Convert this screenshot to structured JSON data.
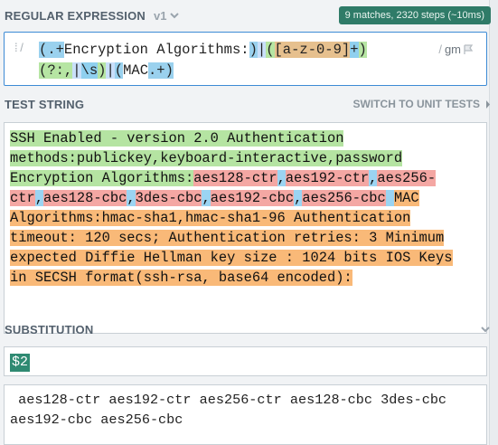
{
  "regex_section": {
    "title": "REGULAR EXPRESSION",
    "flavor": "v1",
    "match_info": "9 matches, 2320 steps (~10ms)",
    "delimiter_open": "/",
    "delimiter_close": "/",
    "flags": "gm",
    "line1": {
      "p_open1": "(",
      "p_dotplus1": ".+",
      "p_literal": "Encryption Algorithms:",
      "p_close1": ")",
      "p_alt1": "|",
      "p_open2": "(",
      "p_class": "[a-z-0-9]",
      "p_plus2": "+",
      "p_close2": ")"
    },
    "line2": {
      "p_open3": "(",
      "p_nc": "?:",
      "p_comma": ",",
      "p_alt2": "|",
      "p_ws": "\\s",
      "p_close3": ")",
      "p_alt3": "|",
      "p_open4": "(",
      "p_mac": "MAC",
      "p_dotplus2": ".+",
      "p_close4": ")"
    }
  },
  "test_section": {
    "title": "TEST STRING",
    "switch_label": "SWITCH TO UNIT TESTS",
    "line1": "SSH Enabled - version 2.0 Authentication",
    "line2": "methods:publickey,keyboard-interactive,password",
    "line3_a": "Encryption Algorithms:",
    "line3_b": "aes128-ctr",
    "line3_c": ",",
    "line3_d": "aes192-ctr",
    "line3_e": ",",
    "line3_f": "aes256-",
    "line4_a": "ctr",
    "line4_b": ",",
    "line4_c": "aes128-cbc",
    "line4_d": ",",
    "line4_e": "3des-cbc",
    "line4_f": ",",
    "line4_g": "aes192-cbc",
    "line4_h": ",",
    "line4_i": "aes256-cbc",
    "line4_j": " ",
    "line4_k": "MAC",
    "line5": "Algorithms:hmac-sha1,hmac-sha1-96 Authentication",
    "line6": "timeout: 120 secs; Authentication retries: 3 Minimum",
    "line7": "expected Diffie Hellman key size : 1024 bits IOS Keys",
    "line8": "in SECSH format(ssh-rsa, base64 encoded):"
  },
  "substitution_section": {
    "title": "SUBSTITUTION",
    "value": "$2",
    "result_line1": " aes128-ctr aes192-ctr aes256-ctr aes128-cbc 3des-cbc",
    "result_line2": "aes192-cbc aes256-cbc"
  },
  "colors": {
    "badge": "#2f7b68",
    "accent_border": "#3d8bd5",
    "match_green": "#b5e4a2",
    "match_red": "#f4a7a3",
    "match_blue": "#9bd4f2",
    "match_orange": "#f9b978"
  }
}
